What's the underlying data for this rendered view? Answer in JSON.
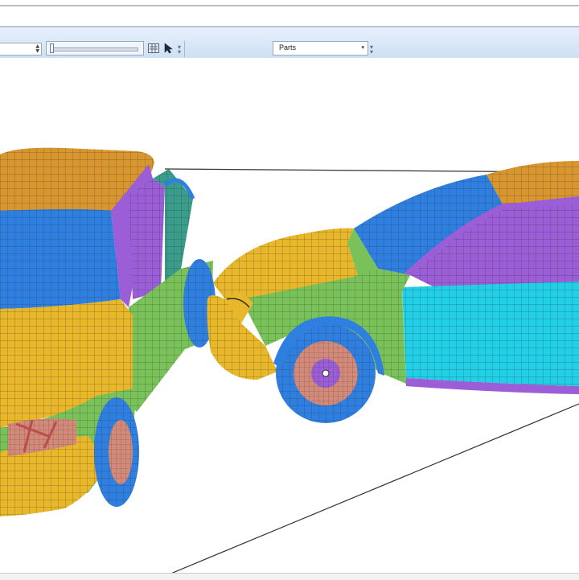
{
  "toolbar": {
    "spin_value": "",
    "parts_select": {
      "selected": "Parts"
    },
    "icons": [
      "counter-icon",
      "select-cursor-icon",
      "toolbar-grip-icon"
    ]
  },
  "viewport": {
    "content": "crash-simulation-mesh",
    "colors": {
      "orange": "#d9962f",
      "blue": "#2f7fe0",
      "purple": "#9b5ed6",
      "cyan": "#21d0e6",
      "green": "#79c25a",
      "yellow": "#e9b72a",
      "salmon": "#d48a78",
      "mesh_line": "#2a2a2a"
    }
  }
}
